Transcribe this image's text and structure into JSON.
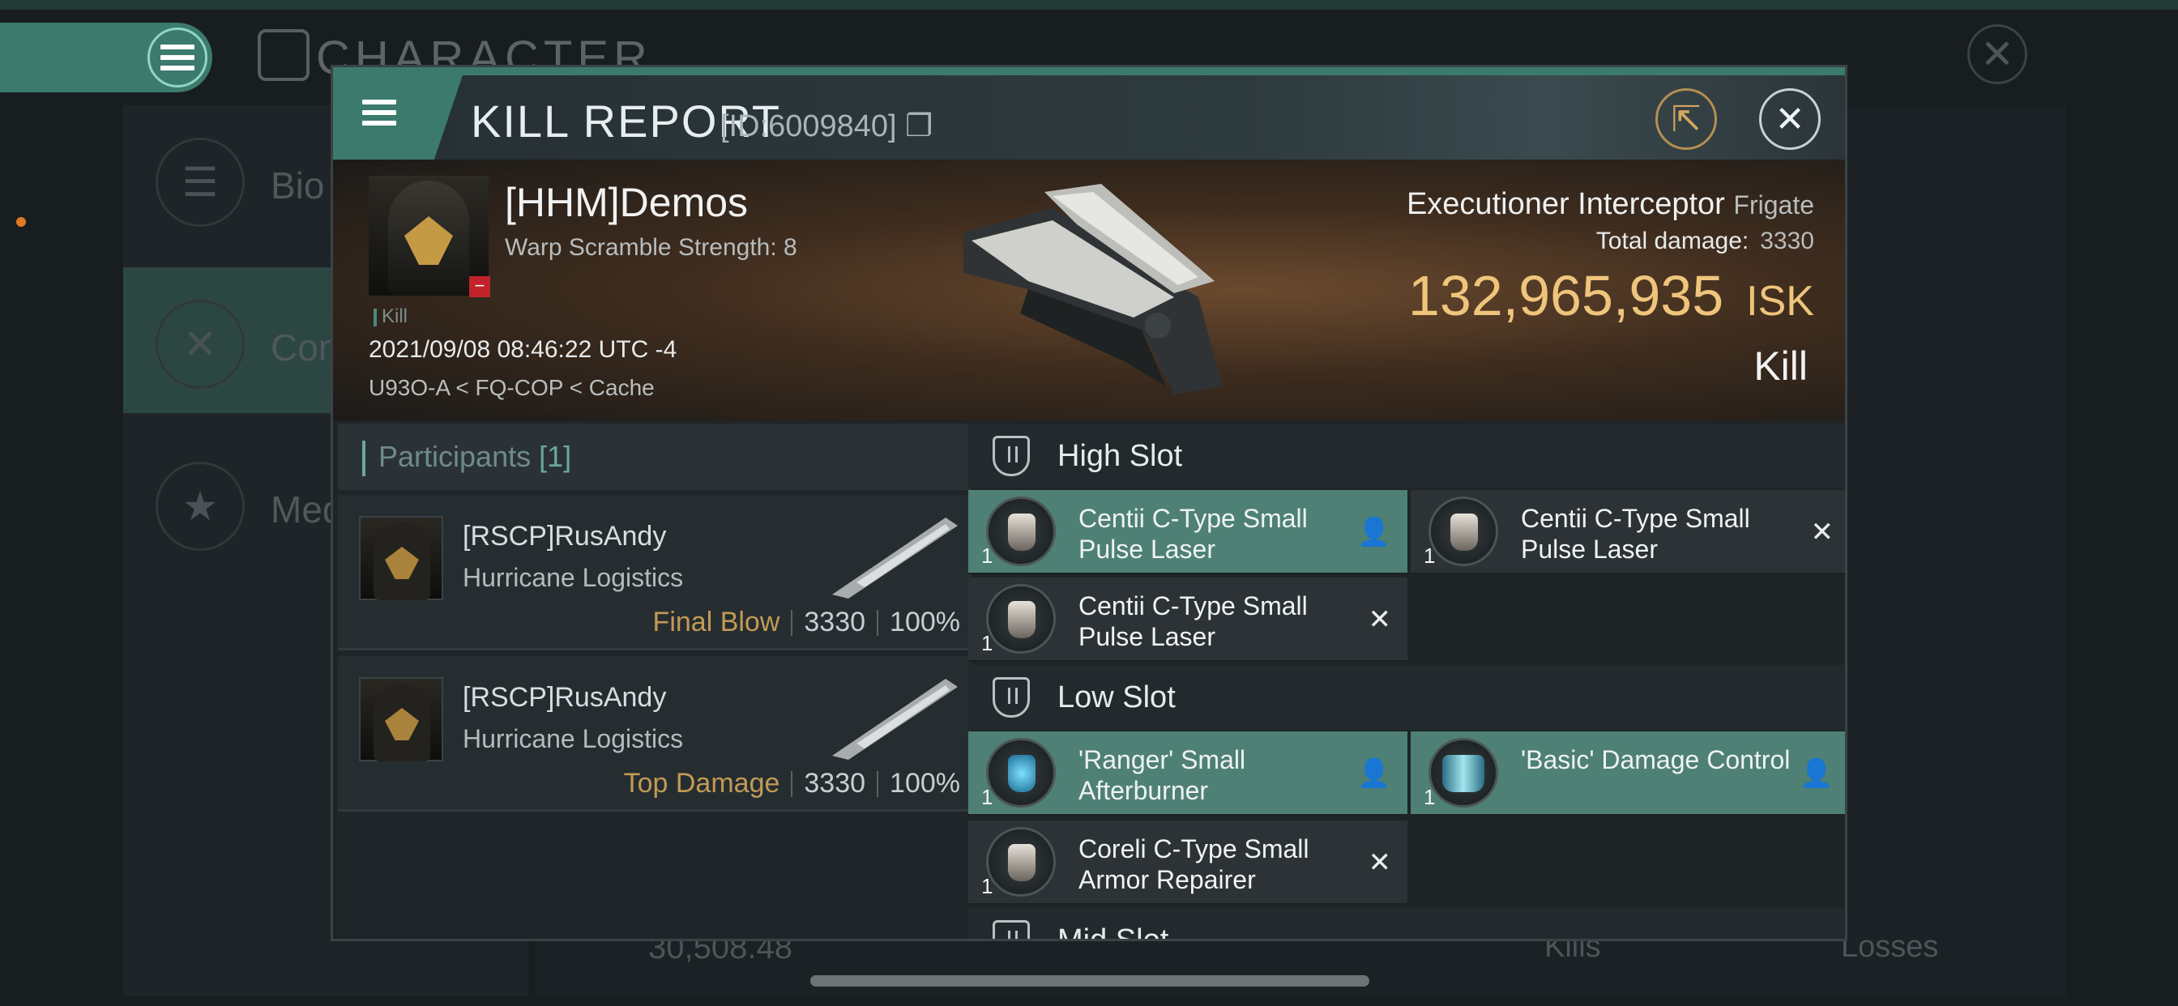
{
  "background": {
    "window_title": "CHARACTER",
    "sidebar": [
      {
        "label": "Bio",
        "icon": "menu-icon",
        "selected": false
      },
      {
        "label": "Com",
        "icon": "crossed-swords-icon",
        "selected": true
      },
      {
        "label": "Med",
        "icon": "star-icon",
        "selected": false
      }
    ],
    "bottom_value": "30,508.48",
    "bottom_kills": "Kills",
    "bottom_losses": "Losses"
  },
  "report": {
    "title": "KILL REPORT",
    "id_text": "[ID:6009840]",
    "copy_icon": "copy-icon",
    "share_icon": "share-icon",
    "close_icon": "close-icon"
  },
  "victim": {
    "name": "[HHM]Demos",
    "warp": "Warp Scramble Strength: 8",
    "type_tag": "Kill",
    "datetime": "2021/09/08 08:46:22 UTC -4",
    "location": "U93O-A < FQ-COP < Cache",
    "ship_name": "Executioner Interceptor",
    "ship_class": "Frigate",
    "total_damage_label": "Total damage:",
    "total_damage": "3330",
    "isk_value": "132,965,935",
    "isk_unit": "ISK",
    "outcome": "Kill"
  },
  "participants": {
    "label": "Participants",
    "count": "[1]",
    "rows": [
      {
        "name": "[RSCP]RusAndy",
        "ship": "Hurricane Logistics",
        "tag": "Final Blow",
        "damage": "3330",
        "percent": "100%"
      },
      {
        "name": "[RSCP]RusAndy",
        "ship": "Hurricane Logistics",
        "tag": "Top Damage",
        "damage": "3330",
        "percent": "100%"
      }
    ]
  },
  "slots": {
    "high": {
      "label": "High Slot",
      "items": [
        {
          "name": "Centii C-Type Small Pulse Laser",
          "qty": "1",
          "status": "alive"
        },
        {
          "name": "Centii C-Type Small Pulse Laser",
          "qty": "1",
          "status": "destroyed"
        },
        {
          "name": "Centii C-Type Small Pulse Laser",
          "qty": "1",
          "status": "destroyed"
        }
      ]
    },
    "low": {
      "label": "Low Slot",
      "items": [
        {
          "name": "'Ranger' Small Afterburner",
          "qty": "1",
          "status": "alive"
        },
        {
          "name": "'Basic' Damage Control",
          "qty": "1",
          "status": "alive"
        },
        {
          "name": "Coreli C-Type Small Armor Repairer",
          "qty": "1",
          "status": "destroyed"
        }
      ]
    },
    "mid": {
      "label": "Mid Slot"
    }
  },
  "colors": {
    "accent": "#3b7a6d",
    "isk": "#efc57c",
    "final_blow": "#c29a55",
    "alive_item": "#4f8075"
  }
}
